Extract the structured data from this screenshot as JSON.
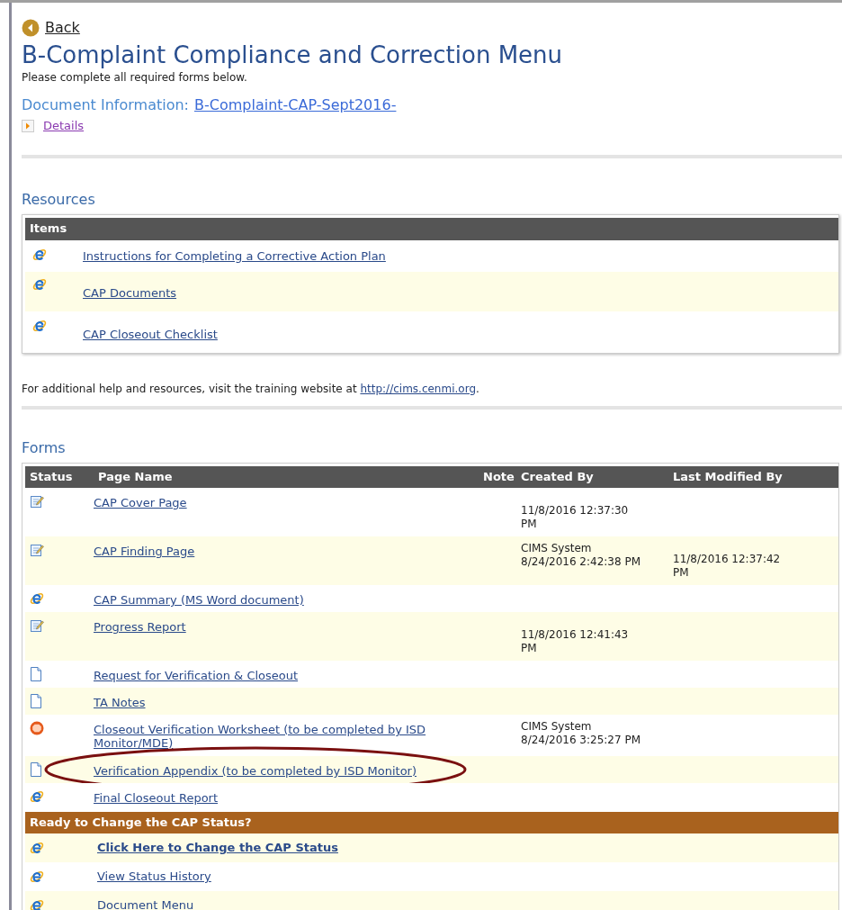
{
  "back": "Back",
  "title": "B-Complaint Compliance and Correction Menu",
  "subtitle": "Please complete all required forms below.",
  "document_info": {
    "label": "Document Information:",
    "link": "B-Complaint-CAP-Sept2016-",
    "details": "Details"
  },
  "resources": {
    "heading": "Resources",
    "column": "Items",
    "items": [
      {
        "kind": "web",
        "label": "Instructions for Completing a Corrective Action Plan"
      },
      {
        "kind": "web",
        "label": "CAP Documents"
      },
      {
        "kind": "web",
        "label": "CAP Closeout Checklist"
      }
    ]
  },
  "help": {
    "text": "For additional help and resources, visit the training website at ",
    "link": "http://cims.cenmi.org",
    "end": "."
  },
  "forms": {
    "heading": "Forms",
    "columns": [
      "Status",
      "Page Name",
      "Note",
      "Created By",
      "Last Modified By"
    ],
    "rows": [
      {
        "kind": "edit",
        "page": "CAP Cover Page",
        "created": [
          "11/8/2016 12:37:30",
          "PM"
        ],
        "modified": [],
        "circled": false
      },
      {
        "kind": "edit",
        "page": "CAP Finding Page",
        "created": [
          "CIMS System",
          "8/24/2016 2:42:38 PM"
        ],
        "modified": [
          "11/8/2016 12:37:42",
          "PM"
        ],
        "circled": false
      },
      {
        "kind": "web",
        "page": "CAP Summary (MS Word document)",
        "created": [],
        "modified": [],
        "circled": false
      },
      {
        "kind": "edit",
        "page": "Progress Report",
        "created": [
          "11/8/2016 12:41:43",
          "PM"
        ],
        "modified": [],
        "circled": false
      },
      {
        "kind": "doc",
        "page": "Request for Verification & Closeout",
        "created": [],
        "modified": [],
        "circled": false
      },
      {
        "kind": "doc",
        "page": "TA Notes",
        "created": [],
        "modified": [],
        "circled": false
      },
      {
        "kind": "stop",
        "page": "Closeout Verification Worksheet (to be completed by ISD Monitor/MDE)",
        "created": [
          "CIMS System",
          "8/24/2016 3:25:27 PM"
        ],
        "modified": [],
        "circled": false
      },
      {
        "kind": "doc",
        "page": "Verification Appendix (to be completed by ISD Monitor)",
        "created": [],
        "modified": [],
        "circled": true
      },
      {
        "kind": "web",
        "page": "Final Closeout Report",
        "created": [],
        "modified": [],
        "circled": false
      }
    ],
    "status_heading": "Ready to Change the CAP Status?",
    "status_links": [
      {
        "kind": "web",
        "label": "Click Here to Change the CAP Status",
        "bold": true
      },
      {
        "kind": "web",
        "label": "View Status History",
        "bold": false
      },
      {
        "kind": "web",
        "label": "Document Menu",
        "bold": false
      }
    ]
  }
}
